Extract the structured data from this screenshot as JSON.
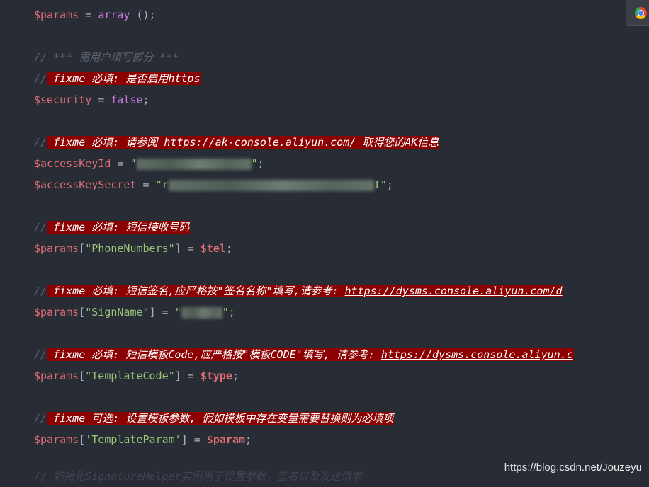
{
  "lines": {
    "l1": {
      "var": "$params",
      "eq": " = ",
      "kw": "array",
      "rest": " ();"
    },
    "l2": {
      "slashes": "//",
      "text": " *** 需用户填写部分 ***"
    },
    "l3": {
      "slashes": "//",
      "text": " fixme 必填: 是否启用https"
    },
    "l4": {
      "var": "$security",
      "eq": " = ",
      "kw": "false",
      "end": ";"
    },
    "l5": {
      "slashes": "//",
      "pre": " fixme 必填: 请参阅 ",
      "link": "https://ak-console.aliyun.com/",
      "post": " 取得您的AK信息"
    },
    "l6": {
      "var": "$accessKeyId",
      "eq": " = ",
      "open": "\"",
      "close": "\";"
    },
    "l7": {
      "var": "$accessKeySecret",
      "eq": " = ",
      "open": "\"",
      "first": "r",
      "last": "I",
      "close": "\";"
    },
    "l8": {
      "slashes": "//",
      "text": " fixme 必填: 短信接收号码"
    },
    "l9": {
      "var": "$params",
      "ob": "[",
      "key": "\"PhoneNumbers\"",
      "cb": "]",
      "eq": " = ",
      "val": "$tel",
      "end": ";"
    },
    "l10": {
      "slashes": "//",
      "pre": " fixme 必填: 短信签名,应严格按\"签名名称\"填写,请参考: ",
      "link": "https://dysms.console.aliyun.com/d"
    },
    "l11": {
      "var": "$params",
      "ob": "[",
      "key": "\"SignName\"",
      "cb": "]",
      "eq": " = ",
      "open": "\"",
      "close": "\";"
    },
    "l12": {
      "slashes": "//",
      "pre": " fixme 必填: 短信模板Code,应严格按\"模板CODE\"填写, 请参考: ",
      "link": "https://dysms.console.aliyun.c"
    },
    "l13": {
      "var": "$params",
      "ob": "[",
      "key": "\"TemplateCode\"",
      "cb": "]",
      "eq": " = ",
      "val": "$type",
      "end": ";"
    },
    "l14": {
      "slashes": "//",
      "text": " fixme 可选: 设置模板参数, 假如模板中存在变量需要替换则为必填项"
    },
    "l15": {
      "var": "$params",
      "ob": "[",
      "key": "'TemplateParam'",
      "cb": "]",
      "eq": " = ",
      "val": "$param",
      "end": ";"
    },
    "l16": {
      "text": "// 初始化SignatureHelper实例用于设置参数，签名以及发送请求"
    }
  },
  "watermark": "https://blog.csdn.net/Jouzeyu",
  "icons": {
    "browser": "chrome-icon"
  },
  "colors": {
    "background": "#282c34",
    "variable": "#e06c75",
    "keyword": "#c678dd",
    "string": "#98c379",
    "comment": "#5c6370",
    "fixme_highlight": "#8b0000"
  }
}
